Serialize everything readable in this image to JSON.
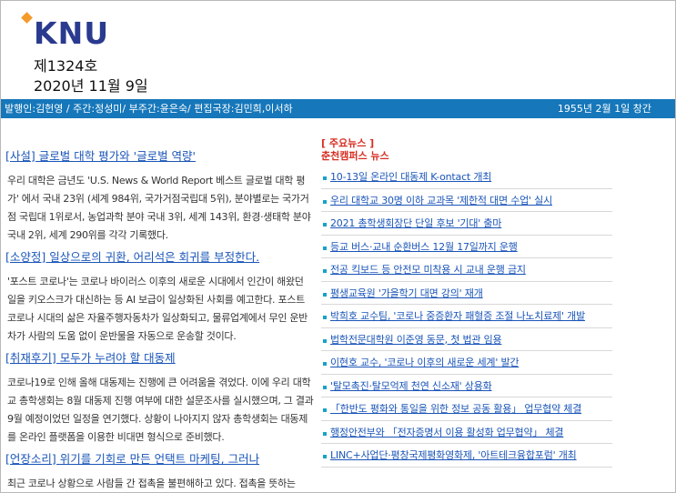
{
  "masthead": {
    "logo": "KNU",
    "issue_no": "제1324호",
    "date": "2020년 11월 9일"
  },
  "staff_bar": {
    "staff": "발행인:김헌영 / 주간:정성미/ 부주간:윤은숙/ 편집국장:김민희,이서하",
    "founded": "1955년 2월 1일 창간"
  },
  "articles": [
    {
      "title": "[사설] 글로벌 대학 평가와 '글로벌 역량'",
      "body": "우리 대학은 금년도 'U.S. News & World Report 베스트 글로벌 대학 평가' 에서 국내 23위 (세계 984위, 국가거점국립대 5위), 분야별로는 국가거점 국립대 1위로서, 농업과학 분야 국내 3위, 세계 143위, 환경·생태학 분야 국내 2위, 세계 290위를 각각 기록했다."
    },
    {
      "title": "[소양정] 일상으로의 귀환, 어리석은 회귀를 부정한다.",
      "body": "'포스트 코로나'는 코로나 바이러스 이후의 새로운 시대에서 인간이 해왔던 일을 키오스크가 대신하는 등 AI 보급이 일상화된 사회를 예고한다. 포스트 코로나 시대의 삶은 자율주행자동차가 일상화되고, 물류업계에서 무인 운반차가 사람의 도움 없이 운반물을 자동으로 운송할 것이다."
    },
    {
      "title": "[취재후기] 모두가 누려야 할 대동제",
      "body": "코로나19로 인해 올해 대동제는 진행에 큰 어려움을 겪었다. 이에 우리 대학교 총학생회는 8월 대동제 진행 여부에 대한 설문조사를 실시했으며, 그 결과 9월 예정이었던 일정을 연기했다. 상황이 나아지지 않자 총학생회는 대동제를 온라인 플랫폼을 이용한 비대면 형식으로 준비했다."
    },
    {
      "title": "[언장소리] 위기를 기회로 만든 언택트 마케팅, 그러나",
      "body": "최근 코로나 상황으로 사람들 간 접촉을 불편해하고 있다. 접촉을 뜻하는 cont"
    }
  ],
  "news": {
    "heading": "[ 주요뉴스 ]",
    "subheading": "춘천캠퍼스 뉴스",
    "items": [
      "10-13일 온라인 대동제 K-ontact 개최",
      "우리 대학교 30명 이하 교과목 '제한적 대면 수업' 실시",
      "2021 총학생회장단 단일 후보 '기대' 출마",
      "등교 버스·교내 순환버스 12월 17일까지 운행",
      "전공 킥보드 등 안전모 미착용 시 교내 운행 금지",
      "평생교육원 '가을학기 대면 강의' 재개",
      "박희호 교수팀, '코로나 중증환자 패혈증 조절 나노치료제' 개발",
      "법학전문대학원 이준영 동문, 첫 법관 임용",
      "이현호 교수, '코로나 이후의 새로운 세계' 발간",
      "'탈모촉진·탈모억제 천연 신소재' 상용화",
      "「한반도 평화와 통일을 위한 정보 공동 활용」 업무협약 체결",
      "행정안전부와 「전자증명서 이용 활성화 업무협약」 체결",
      "LINC+사업단·평창국제평화영화제, '아트테크융합포럼' 개최"
    ]
  },
  "colors": {
    "brand_blue": "#1677ba",
    "logo_navy": "#2a3a8f",
    "logo_accent": "#f39b2b",
    "link_blue": "#1a55b8",
    "news_red": "#d62d20",
    "bullet_teal": "#17a2c9"
  }
}
